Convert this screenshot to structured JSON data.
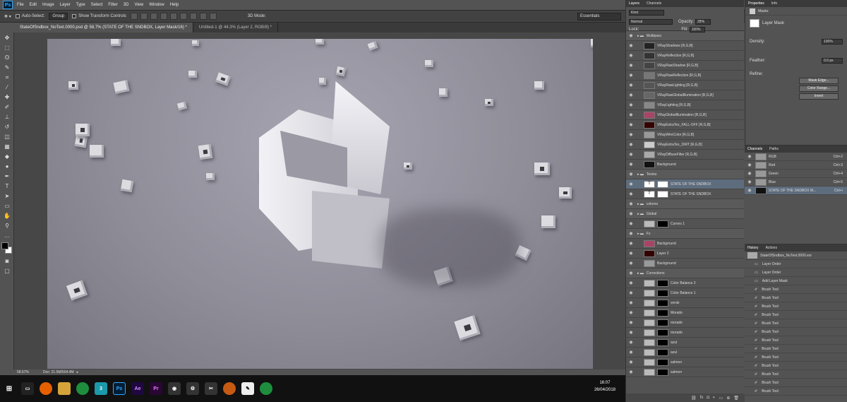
{
  "app": {
    "logo": "Ps"
  },
  "menu": [
    "File",
    "Edit",
    "Image",
    "Layer",
    "Type",
    "Select",
    "Filter",
    "3D",
    "View",
    "Window",
    "Help"
  ],
  "options": {
    "auto_select_label": "Auto-Select:",
    "auto_select_value": "Group",
    "transform_label": "Show Transform Controls",
    "mode3d_label": "3D Mode:",
    "workspace": "Essentials"
  },
  "tabs": [
    {
      "label": "StateOfSndbox_NoText.0000.psd @ 58.7% (STATE OF THE SNDBOX, Layer Mask/16) *",
      "active": true
    },
    {
      "label": "Untitled-1 @ 44.3% (Layer 2, RGB/8) *",
      "active": false
    }
  ],
  "status": {
    "zoom": "58.67%",
    "doc": "Doc: 21.5M/504.4M"
  },
  "taskbar": {
    "time": "16:07",
    "date": "26/04/2018"
  },
  "layers_panel": {
    "tabs": [
      "Layers",
      "Channels"
    ],
    "kind": "Kind",
    "blend": "Normal",
    "opacity_label": "Opacity:",
    "opacity": "28%",
    "lock_label": "Lock:",
    "fill_label": "Fill:",
    "fill": "100%",
    "rows": [
      {
        "name": "Multipass",
        "type": "group"
      },
      {
        "name": "VRayShadows [R,G,B]",
        "type": "layer"
      },
      {
        "name": "VRayReflection [R,G,B]",
        "type": "layer"
      },
      {
        "name": "VRayRawShadow [R,G,B]",
        "type": "layer"
      },
      {
        "name": "VRayRawReflection [R,G,B]",
        "type": "layer"
      },
      {
        "name": "VRayRawLighting [R,G,B]",
        "type": "layer"
      },
      {
        "name": "VRayRawGlobalIllumination [R,G,B]",
        "type": "layer"
      },
      {
        "name": "VRayLighting [R,G,B]",
        "type": "layer"
      },
      {
        "name": "VRayGlobalIllumination [R,G,B]",
        "type": "layer"
      },
      {
        "name": "VRayExtraTex_FALL-OFF [R,G,B]",
        "type": "layer"
      },
      {
        "name": "VRayWireColor [R,G,B]",
        "type": "layer"
      },
      {
        "name": "VRayExtraTex_DIRT [R,G,B]",
        "type": "layer"
      },
      {
        "name": "VRayDiffuseFilter [R,G,B]",
        "type": "layer"
      },
      {
        "name": "Background",
        "type": "layer"
      },
      {
        "name": "Textos",
        "type": "group"
      },
      {
        "name": "STATE OF THE SNDBOX",
        "type": "text",
        "selected": true
      },
      {
        "name": "STATE OF THE SNDBOX",
        "type": "text"
      },
      {
        "name": "colores",
        "type": "group"
      },
      {
        "name": "Global",
        "type": "group"
      },
      {
        "name": "Curves 1",
        "type": "adj"
      },
      {
        "name": "Fx",
        "type": "group"
      },
      {
        "name": "Background",
        "type": "layer"
      },
      {
        "name": "Layer 2",
        "type": "layer"
      },
      {
        "name": "Background",
        "type": "layer"
      },
      {
        "name": "Corrections",
        "type": "group"
      },
      {
        "name": "Color Balance 2",
        "type": "adj"
      },
      {
        "name": "Color Balance 1",
        "type": "adj"
      },
      {
        "name": "verde",
        "type": "adj"
      },
      {
        "name": "Morado",
        "type": "adj"
      },
      {
        "name": "morado",
        "type": "adj"
      },
      {
        "name": "morado",
        "type": "adj"
      },
      {
        "name": "azul",
        "type": "adj"
      },
      {
        "name": "azul",
        "type": "adj"
      },
      {
        "name": "salmon",
        "type": "adj"
      },
      {
        "name": "salmon",
        "type": "adj"
      }
    ]
  },
  "properties": {
    "tabs": [
      "Properties",
      "Info"
    ],
    "section": "Masks",
    "mask_label": "Layer Mask",
    "density_label": "Density:",
    "density": "100%",
    "feather_label": "Feather:",
    "feather": "0.0 px",
    "refine_label": "Refine:",
    "buttons": [
      "Mask Edge...",
      "Color Range...",
      "Invert"
    ]
  },
  "channels": {
    "tabs": [
      "Channels",
      "Paths"
    ],
    "rows": [
      {
        "name": "RGB",
        "shortcut": "Ctrl+2"
      },
      {
        "name": "Red",
        "shortcut": "Ctrl+3"
      },
      {
        "name": "Green",
        "shortcut": "Ctrl+4"
      },
      {
        "name": "Blue",
        "shortcut": "Ctrl+5"
      },
      {
        "name": "STATE OF THE SNDBOX M...",
        "shortcut": "Ctrl+\\"
      }
    ]
  },
  "history": {
    "tabs": [
      "History",
      "Actions"
    ],
    "snapshot": "StateOfSndbox_NoText.0000.exr",
    "rows": [
      "Layer Order",
      "Layer Order",
      "Add Layer Mask",
      "Brush Tool",
      "Brush Tool",
      "Brush Tool",
      "Brush Tool",
      "Brush Tool",
      "Brush Tool",
      "Brush Tool",
      "Brush Tool",
      "Brush Tool",
      "Brush Tool",
      "Brush Tool",
      "Brush Tool",
      "Brush Tool"
    ]
  }
}
